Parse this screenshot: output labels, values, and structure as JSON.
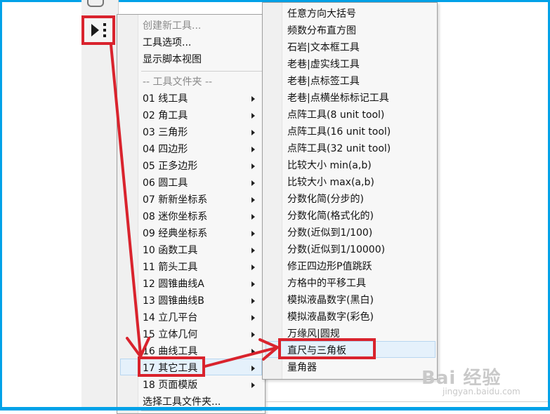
{
  "menu": {
    "items": [
      {
        "label": "创建新工具...",
        "disabled": true
      },
      {
        "label": "工具选项...",
        "disabled": false
      },
      {
        "label": "显示脚本视图",
        "disabled": false
      },
      {
        "label": "-- 工具文件夹 --",
        "disabled": true
      },
      {
        "label": "01 线工具",
        "submenu": true
      },
      {
        "label": "02 角工具",
        "submenu": true
      },
      {
        "label": "03 三角形",
        "submenu": true
      },
      {
        "label": "04 四边形",
        "submenu": true
      },
      {
        "label": "05 正多边形",
        "submenu": true
      },
      {
        "label": "06 圆工具",
        "submenu": true
      },
      {
        "label": "07 新新坐标系",
        "submenu": true
      },
      {
        "label": "08 迷你坐标系",
        "submenu": true
      },
      {
        "label": "09 经典坐标系",
        "submenu": true
      },
      {
        "label": "10 函数工具",
        "submenu": true
      },
      {
        "label": "11 箭头工具",
        "submenu": true
      },
      {
        "label": "12 圆锥曲线A",
        "submenu": true
      },
      {
        "label": "13 圆锥曲线B",
        "submenu": true
      },
      {
        "label": "14 立几平台",
        "submenu": true
      },
      {
        "label": "15 立体几何",
        "submenu": true
      },
      {
        "label": "16 曲线工具",
        "submenu": true
      },
      {
        "label": "17 其它工具",
        "submenu": true,
        "selected": true
      },
      {
        "label": "18 页面模版",
        "submenu": true
      },
      {
        "label": "选择工具文件夹..."
      }
    ]
  },
  "submenu": {
    "items": [
      "任意方向大括号",
      "频数分布直方图",
      "石岩|文本框工具",
      "老巷|虚实线工具",
      "老巷|点标签工具",
      "老巷|点横坐标标记工具",
      "点阵工具(8 unit tool)",
      "点阵工具(16 unit tool)",
      "点阵工具(32 unit tool)",
      "比较大小 min(a,b)",
      "比较大小 max(a,b)",
      "分数化简(分步的)",
      "分数化简(格式化的)",
      "分数(近似到1/100)",
      "分数(近似到1/10000)",
      "修正四边形P值跳跃",
      "方格中的平移工具",
      "模拟液晶数字(黑白)",
      "模拟液晶数字(彩色)",
      "万缘风|圆规",
      "直尺与三角板",
      "量角器"
    ],
    "selected_index": 20
  },
  "annotation": {
    "color": "#d9232d"
  },
  "watermark": {
    "main": "Bai 经验",
    "sub": "jingyan.baidu.com"
  },
  "colors": {
    "frame": "#00a2e8",
    "highlight": "#e5f1fb"
  }
}
